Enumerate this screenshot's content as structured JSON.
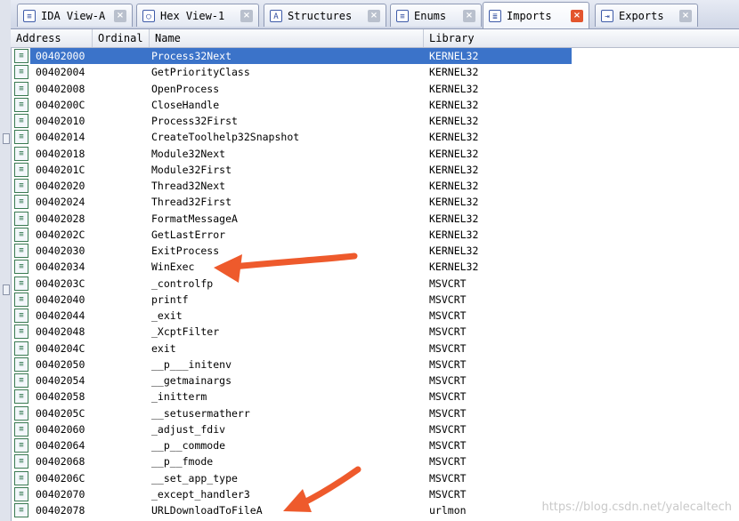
{
  "tabs": [
    {
      "label": "IDA View-A",
      "icon": "ida-view-icon",
      "glyph": "≡",
      "active": false
    },
    {
      "label": "Hex View-1",
      "icon": "hex-view-icon",
      "glyph": "◯",
      "active": false
    },
    {
      "label": "Structures",
      "icon": "structures-icon",
      "glyph": "A",
      "active": false
    },
    {
      "label": "Enums",
      "icon": "enums-icon",
      "glyph": "≡",
      "active": false
    },
    {
      "label": "Imports",
      "icon": "imports-icon",
      "glyph": "≣",
      "active": true
    },
    {
      "label": "Exports",
      "icon": "exports-icon",
      "glyph": "⇥",
      "active": false
    }
  ],
  "close_glyph": "×",
  "columns": {
    "address": "Address",
    "ordinal": "Ordinal",
    "name": "Name",
    "library": "Library"
  },
  "row_icon_glyph": "≡",
  "rows": [
    {
      "address": "00402000",
      "ordinal": "",
      "name": "Process32Next",
      "library": "KERNEL32",
      "selected": true
    },
    {
      "address": "00402004",
      "ordinal": "",
      "name": "GetPriorityClass",
      "library": "KERNEL32"
    },
    {
      "address": "00402008",
      "ordinal": "",
      "name": "OpenProcess",
      "library": "KERNEL32"
    },
    {
      "address": "0040200C",
      "ordinal": "",
      "name": "CloseHandle",
      "library": "KERNEL32"
    },
    {
      "address": "00402010",
      "ordinal": "",
      "name": "Process32First",
      "library": "KERNEL32"
    },
    {
      "address": "00402014",
      "ordinal": "",
      "name": "CreateToolhelp32Snapshot",
      "library": "KERNEL32"
    },
    {
      "address": "00402018",
      "ordinal": "",
      "name": "Module32Next",
      "library": "KERNEL32"
    },
    {
      "address": "0040201C",
      "ordinal": "",
      "name": "Module32First",
      "library": "KERNEL32"
    },
    {
      "address": "00402020",
      "ordinal": "",
      "name": "Thread32Next",
      "library": "KERNEL32"
    },
    {
      "address": "00402024",
      "ordinal": "",
      "name": "Thread32First",
      "library": "KERNEL32"
    },
    {
      "address": "00402028",
      "ordinal": "",
      "name": "FormatMessageA",
      "library": "KERNEL32"
    },
    {
      "address": "0040202C",
      "ordinal": "",
      "name": "GetLastError",
      "library": "KERNEL32"
    },
    {
      "address": "00402030",
      "ordinal": "",
      "name": "ExitProcess",
      "library": "KERNEL32"
    },
    {
      "address": "00402034",
      "ordinal": "",
      "name": "WinExec",
      "library": "KERNEL32"
    },
    {
      "address": "0040203C",
      "ordinal": "",
      "name": "_controlfp",
      "library": "MSVCRT"
    },
    {
      "address": "00402040",
      "ordinal": "",
      "name": "printf",
      "library": "MSVCRT"
    },
    {
      "address": "00402044",
      "ordinal": "",
      "name": "_exit",
      "library": "MSVCRT"
    },
    {
      "address": "00402048",
      "ordinal": "",
      "name": "_XcptFilter",
      "library": "MSVCRT"
    },
    {
      "address": "0040204C",
      "ordinal": "",
      "name": "exit",
      "library": "MSVCRT"
    },
    {
      "address": "00402050",
      "ordinal": "",
      "name": "__p___initenv",
      "library": "MSVCRT"
    },
    {
      "address": "00402054",
      "ordinal": "",
      "name": "__getmainargs",
      "library": "MSVCRT"
    },
    {
      "address": "00402058",
      "ordinal": "",
      "name": "_initterm",
      "library": "MSVCRT"
    },
    {
      "address": "0040205C",
      "ordinal": "",
      "name": "__setusermatherr",
      "library": "MSVCRT"
    },
    {
      "address": "00402060",
      "ordinal": "",
      "name": "_adjust_fdiv",
      "library": "MSVCRT"
    },
    {
      "address": "00402064",
      "ordinal": "",
      "name": "__p__commode",
      "library": "MSVCRT"
    },
    {
      "address": "00402068",
      "ordinal": "",
      "name": "__p__fmode",
      "library": "MSVCRT"
    },
    {
      "address": "0040206C",
      "ordinal": "",
      "name": "__set_app_type",
      "library": "MSVCRT"
    },
    {
      "address": "00402070",
      "ordinal": "",
      "name": "_except_handler3",
      "library": "MSVCRT"
    },
    {
      "address": "00402078",
      "ordinal": "",
      "name": "URLDownloadToFileA",
      "library": "urlmon"
    }
  ],
  "annotation_color": "#ee5a2c",
  "watermark": "https://blog.csdn.net/yalecaltech"
}
